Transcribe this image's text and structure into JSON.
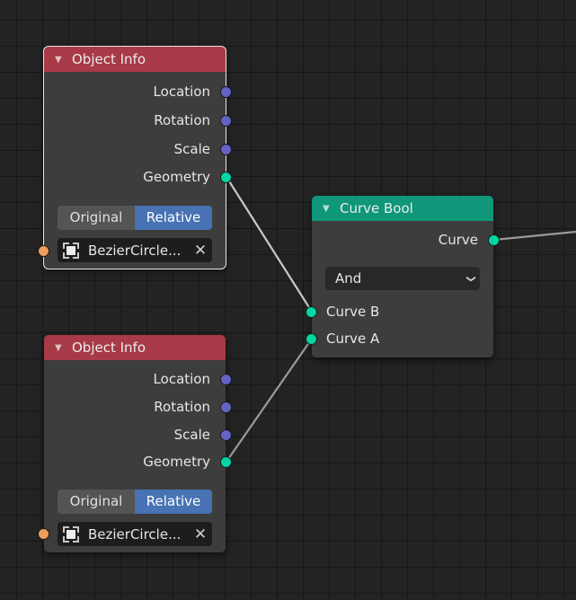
{
  "nodes": {
    "object_info_1": {
      "title": "Object Info",
      "selected": true,
      "outputs": [
        "Location",
        "Rotation",
        "Scale",
        "Geometry"
      ],
      "transform_space": {
        "options": [
          "Original",
          "Relative"
        ],
        "active": "Relative"
      },
      "object_field": {
        "value": "BezierCircle...",
        "clear_glyph": "✕"
      }
    },
    "object_info_2": {
      "title": "Object Info",
      "selected": false,
      "outputs": [
        "Location",
        "Rotation",
        "Scale",
        "Geometry"
      ],
      "transform_space": {
        "options": [
          "Original",
          "Relative"
        ],
        "active": "Relative"
      },
      "object_field": {
        "value": "BezierCircle...",
        "clear_glyph": "✕"
      }
    },
    "curve_bool": {
      "title": "Curve Bool",
      "outputs": [
        "Curve"
      ],
      "operation": {
        "value": "And"
      },
      "inputs": [
        "Curve B",
        "Curve A"
      ]
    }
  },
  "icons": {
    "collapse": "▼",
    "dropdown": "⌄"
  },
  "colors": {
    "header_object_info": "#a83946",
    "header_curve_bool": "#10977a",
    "socket_vector": "#6363c7",
    "socket_geometry": "#00d6a3",
    "socket_object": "#ed9e5c",
    "toggle_active": "#4772b3"
  },
  "links": [
    {
      "from": "object_info_1.Geometry",
      "to": "curve_bool.Curve B"
    },
    {
      "from": "object_info_2.Geometry",
      "to": "curve_bool.Curve A"
    },
    {
      "from": "curve_bool.Curve",
      "to": "offscreen"
    }
  ]
}
